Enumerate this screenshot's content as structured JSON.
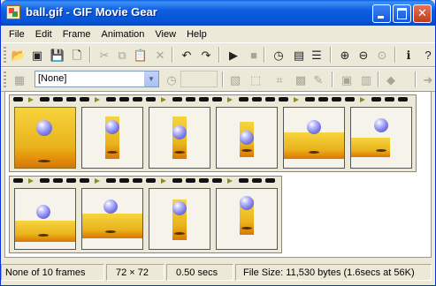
{
  "window": {
    "title": "ball.gif - GIF Movie Gear"
  },
  "menu": [
    "File",
    "Edit",
    "Frame",
    "Animation",
    "View",
    "Help"
  ],
  "toolbar1": [
    {
      "name": "open-icon",
      "glyph": "📂",
      "enabled": true
    },
    {
      "name": "save-icon-alt",
      "glyph": "▣",
      "enabled": true
    },
    {
      "name": "save-icon",
      "glyph": "💾",
      "enabled": true
    },
    {
      "name": "new-icon",
      "glyph": "🗋",
      "enabled": true
    },
    {
      "name": "cut-icon",
      "glyph": "✂",
      "enabled": false
    },
    {
      "name": "copy-icon",
      "glyph": "⧉",
      "enabled": false
    },
    {
      "name": "paste-icon",
      "glyph": "📋",
      "enabled": true
    },
    {
      "name": "delete-icon",
      "glyph": "✕",
      "enabled": false
    },
    {
      "name": "undo-icon",
      "glyph": "↶",
      "enabled": true
    },
    {
      "name": "redo-icon",
      "glyph": "↷",
      "enabled": true
    },
    {
      "name": "play-icon",
      "glyph": "▶",
      "enabled": true
    },
    {
      "name": "stop-icon",
      "glyph": "■",
      "enabled": false
    },
    {
      "name": "timing-icon",
      "glyph": "◷",
      "enabled": true
    },
    {
      "name": "film-icon",
      "glyph": "▤",
      "enabled": true
    },
    {
      "name": "palette-icon",
      "glyph": "☰",
      "enabled": true
    },
    {
      "name": "zoom-in-icon",
      "glyph": "⊕",
      "enabled": true
    },
    {
      "name": "zoom-out-icon",
      "glyph": "⊖",
      "enabled": true
    },
    {
      "name": "zoom-reset-icon",
      "glyph": "⊙",
      "enabled": false
    },
    {
      "name": "info-icon",
      "glyph": "ℹ",
      "enabled": true
    },
    {
      "name": "help-icon",
      "glyph": "?",
      "enabled": true
    }
  ],
  "toolbar2": {
    "properties_icon": "▦",
    "disposal_select": {
      "value": "[None]"
    },
    "delay_icon": "◷",
    "delay_value": "",
    "icons": [
      {
        "name": "frame-props-icon",
        "glyph": "▧"
      },
      {
        "name": "frame-transform-icon",
        "glyph": "⬚"
      },
      {
        "name": "crop-icon",
        "glyph": "⌗"
      },
      {
        "name": "frame-edit-icon",
        "glyph": "▩"
      },
      {
        "name": "eyedropper-icon",
        "glyph": "✎"
      },
      {
        "name": "insert-frame-icon",
        "glyph": "▣"
      },
      {
        "name": "duplicate-frame-icon",
        "glyph": "▥"
      },
      {
        "name": "transparency-icon",
        "glyph": "◆"
      },
      {
        "name": "export-icon",
        "glyph": "➜"
      }
    ]
  },
  "frames": [
    {
      "index": 1,
      "selected": true
    },
    {
      "index": 2
    },
    {
      "index": 3
    },
    {
      "index": 4
    },
    {
      "index": 5
    },
    {
      "index": 6
    },
    {
      "index": 7
    },
    {
      "index": 8
    },
    {
      "index": 9
    },
    {
      "index": 10
    }
  ],
  "status": {
    "frames": "None of 10 frames",
    "size": "72 × 72",
    "delay": "0.50 secs",
    "filesize": "File Size: 11,530 bytes  (1.6secs at 56K)"
  },
  "colors": {
    "titlebar": "#0553d6",
    "sky": "#f6d43e",
    "ground": "#d4780a",
    "ball": "#7d7de6"
  }
}
